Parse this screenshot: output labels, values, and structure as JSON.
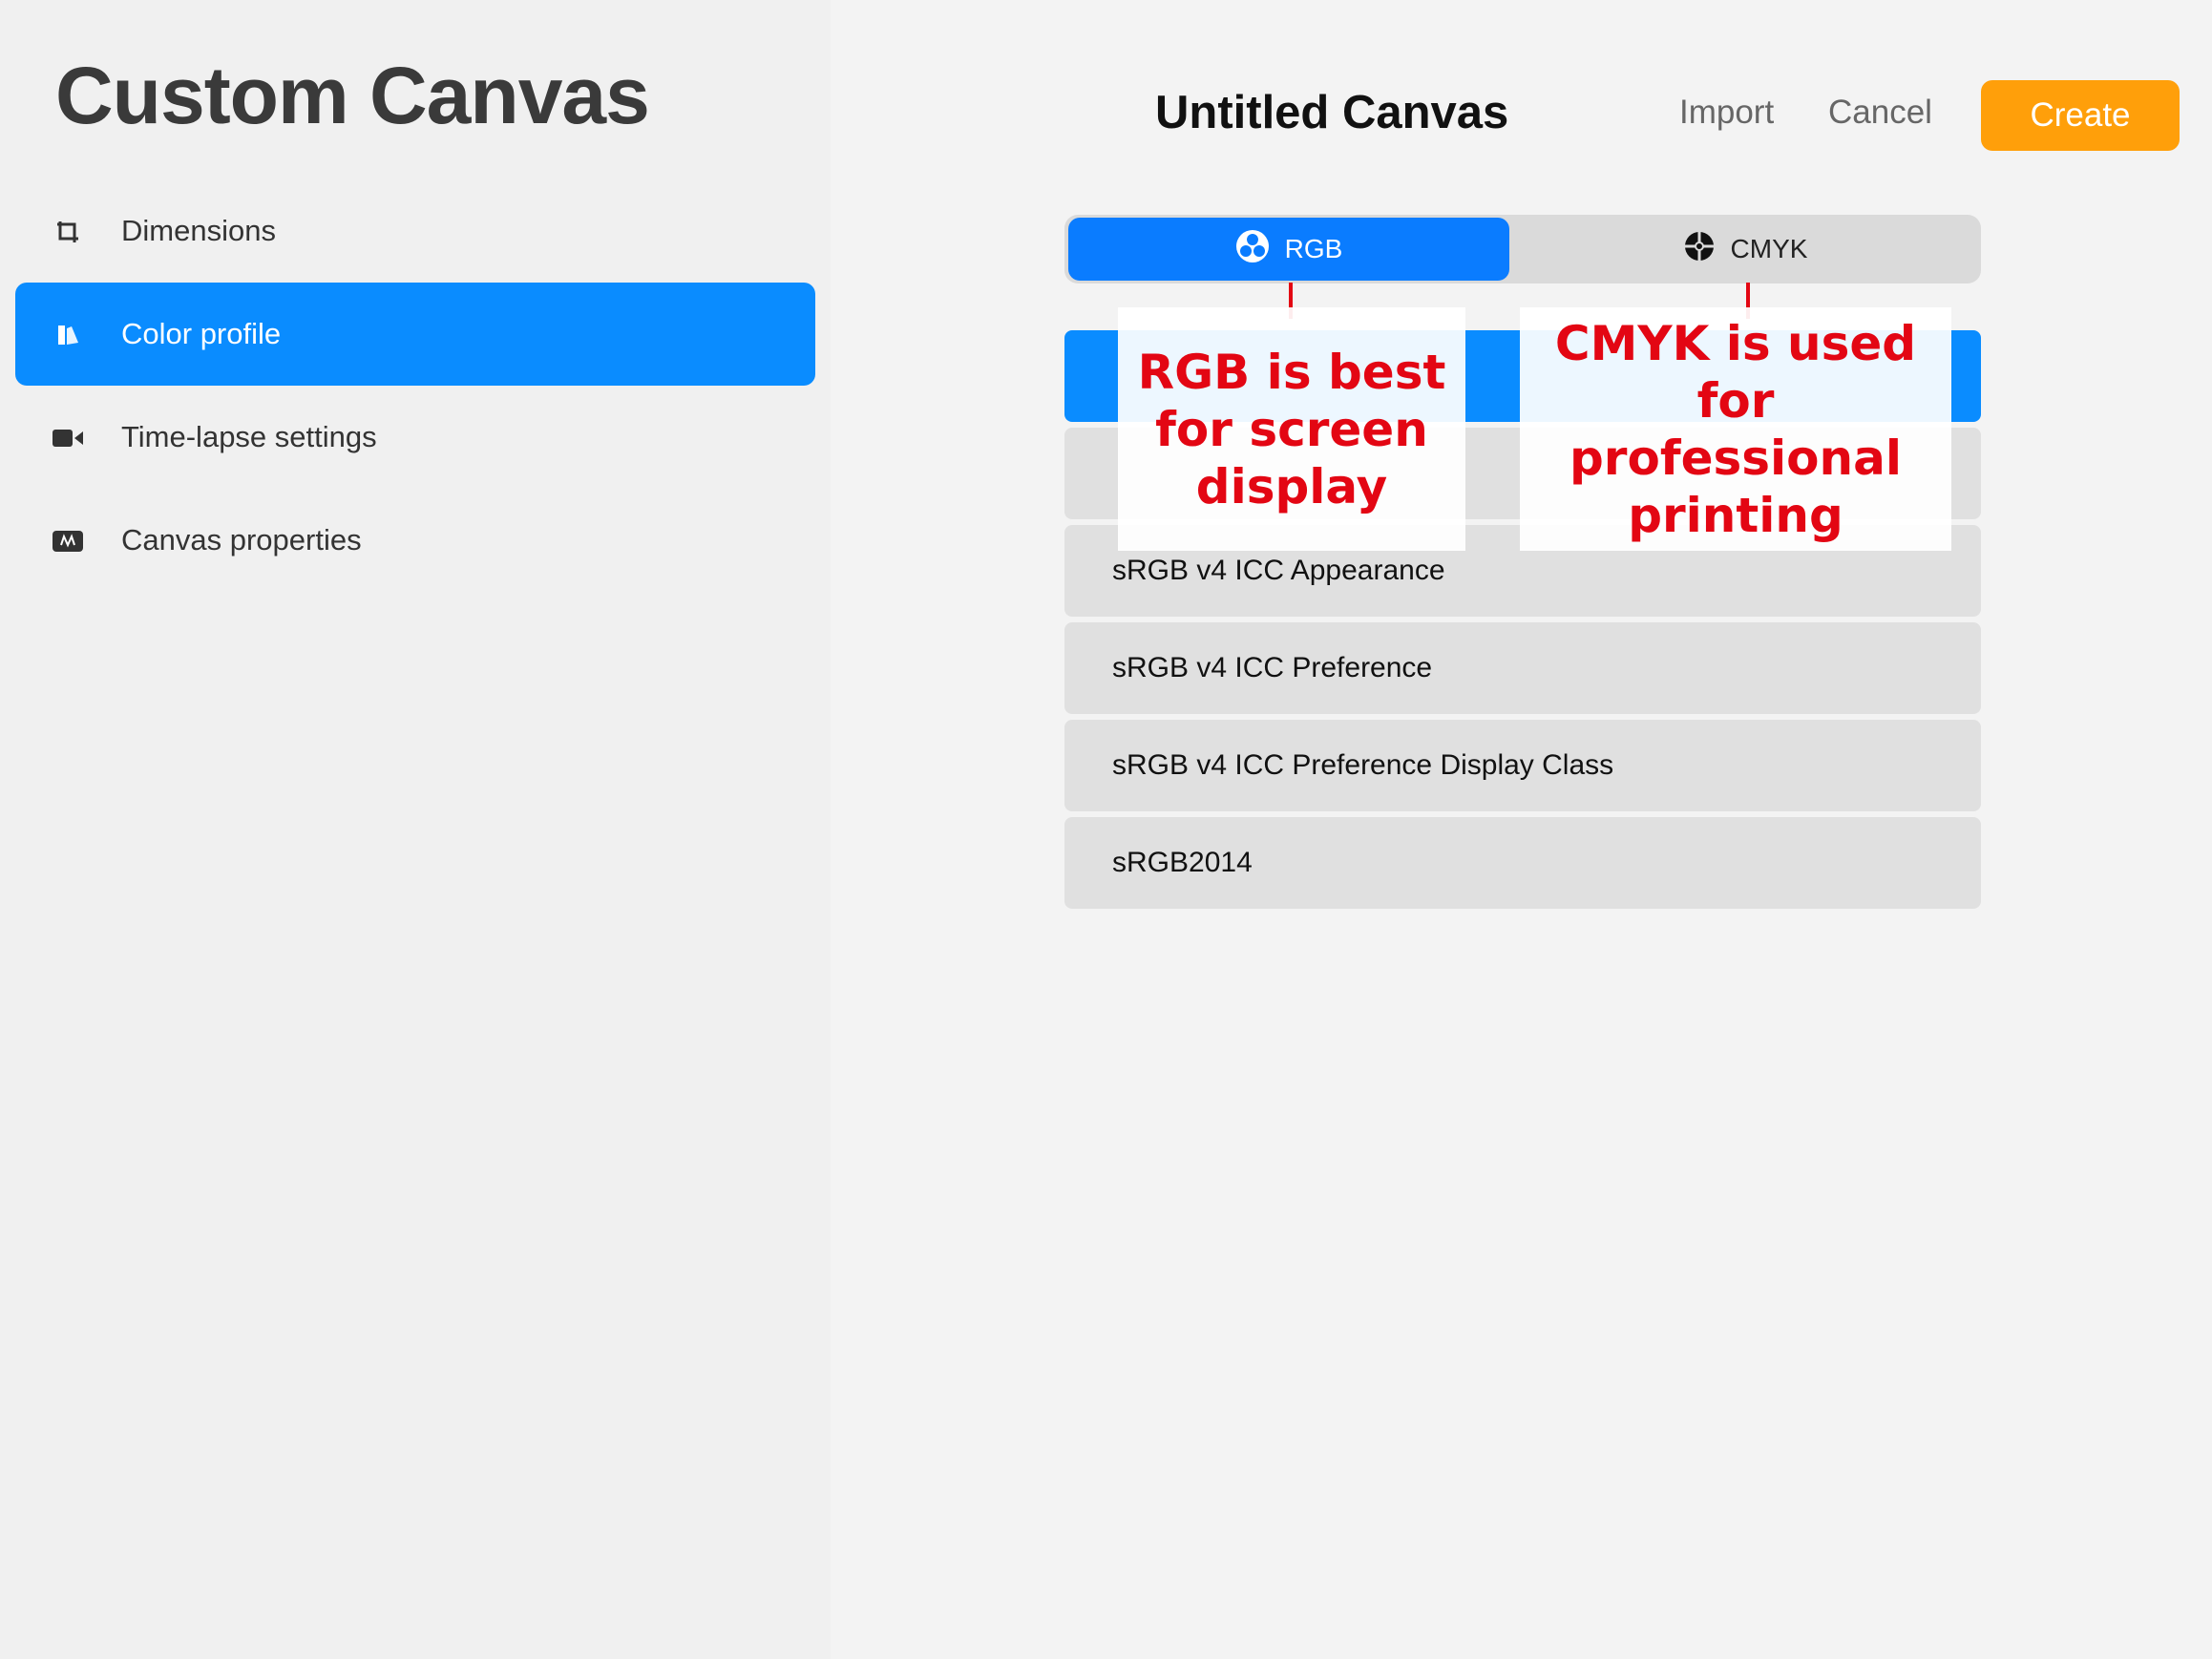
{
  "sidebar": {
    "title": "Custom Canvas",
    "items": [
      {
        "label": "Dimensions",
        "icon": "crop-icon",
        "active": false
      },
      {
        "label": "Color profile",
        "icon": "color-profile-icon",
        "active": true
      },
      {
        "label": "Time-lapse settings",
        "icon": "video-camera-icon",
        "active": false
      },
      {
        "label": "Canvas properties",
        "icon": "canvas-properties-icon",
        "active": false
      }
    ]
  },
  "header": {
    "title": "Untitled Canvas",
    "import_label": "Import",
    "cancel_label": "Cancel",
    "create_label": "Create"
  },
  "color_mode": {
    "options": [
      {
        "label": "RGB",
        "icon": "rgb-icon",
        "selected": true
      },
      {
        "label": "CMYK",
        "icon": "cmyk-icon",
        "selected": false
      }
    ]
  },
  "profiles": [
    {
      "label": "",
      "selected": true
    },
    {
      "label": "",
      "selected": false
    },
    {
      "label": "sRGB v4 ICC Appearance",
      "selected": false
    },
    {
      "label": "sRGB v4 ICC Preference",
      "selected": false
    },
    {
      "label": "sRGB v4 ICC Preference Display Class",
      "selected": false
    },
    {
      "label": "sRGB2014",
      "selected": false
    }
  ],
  "annotations": {
    "rgb": "RGB is best for screen display",
    "cmyk": "CMYK is used for professional printing"
  },
  "colors": {
    "accent": "#0a8cff",
    "create": "#ff9f0a",
    "callout_text": "#e30613"
  }
}
